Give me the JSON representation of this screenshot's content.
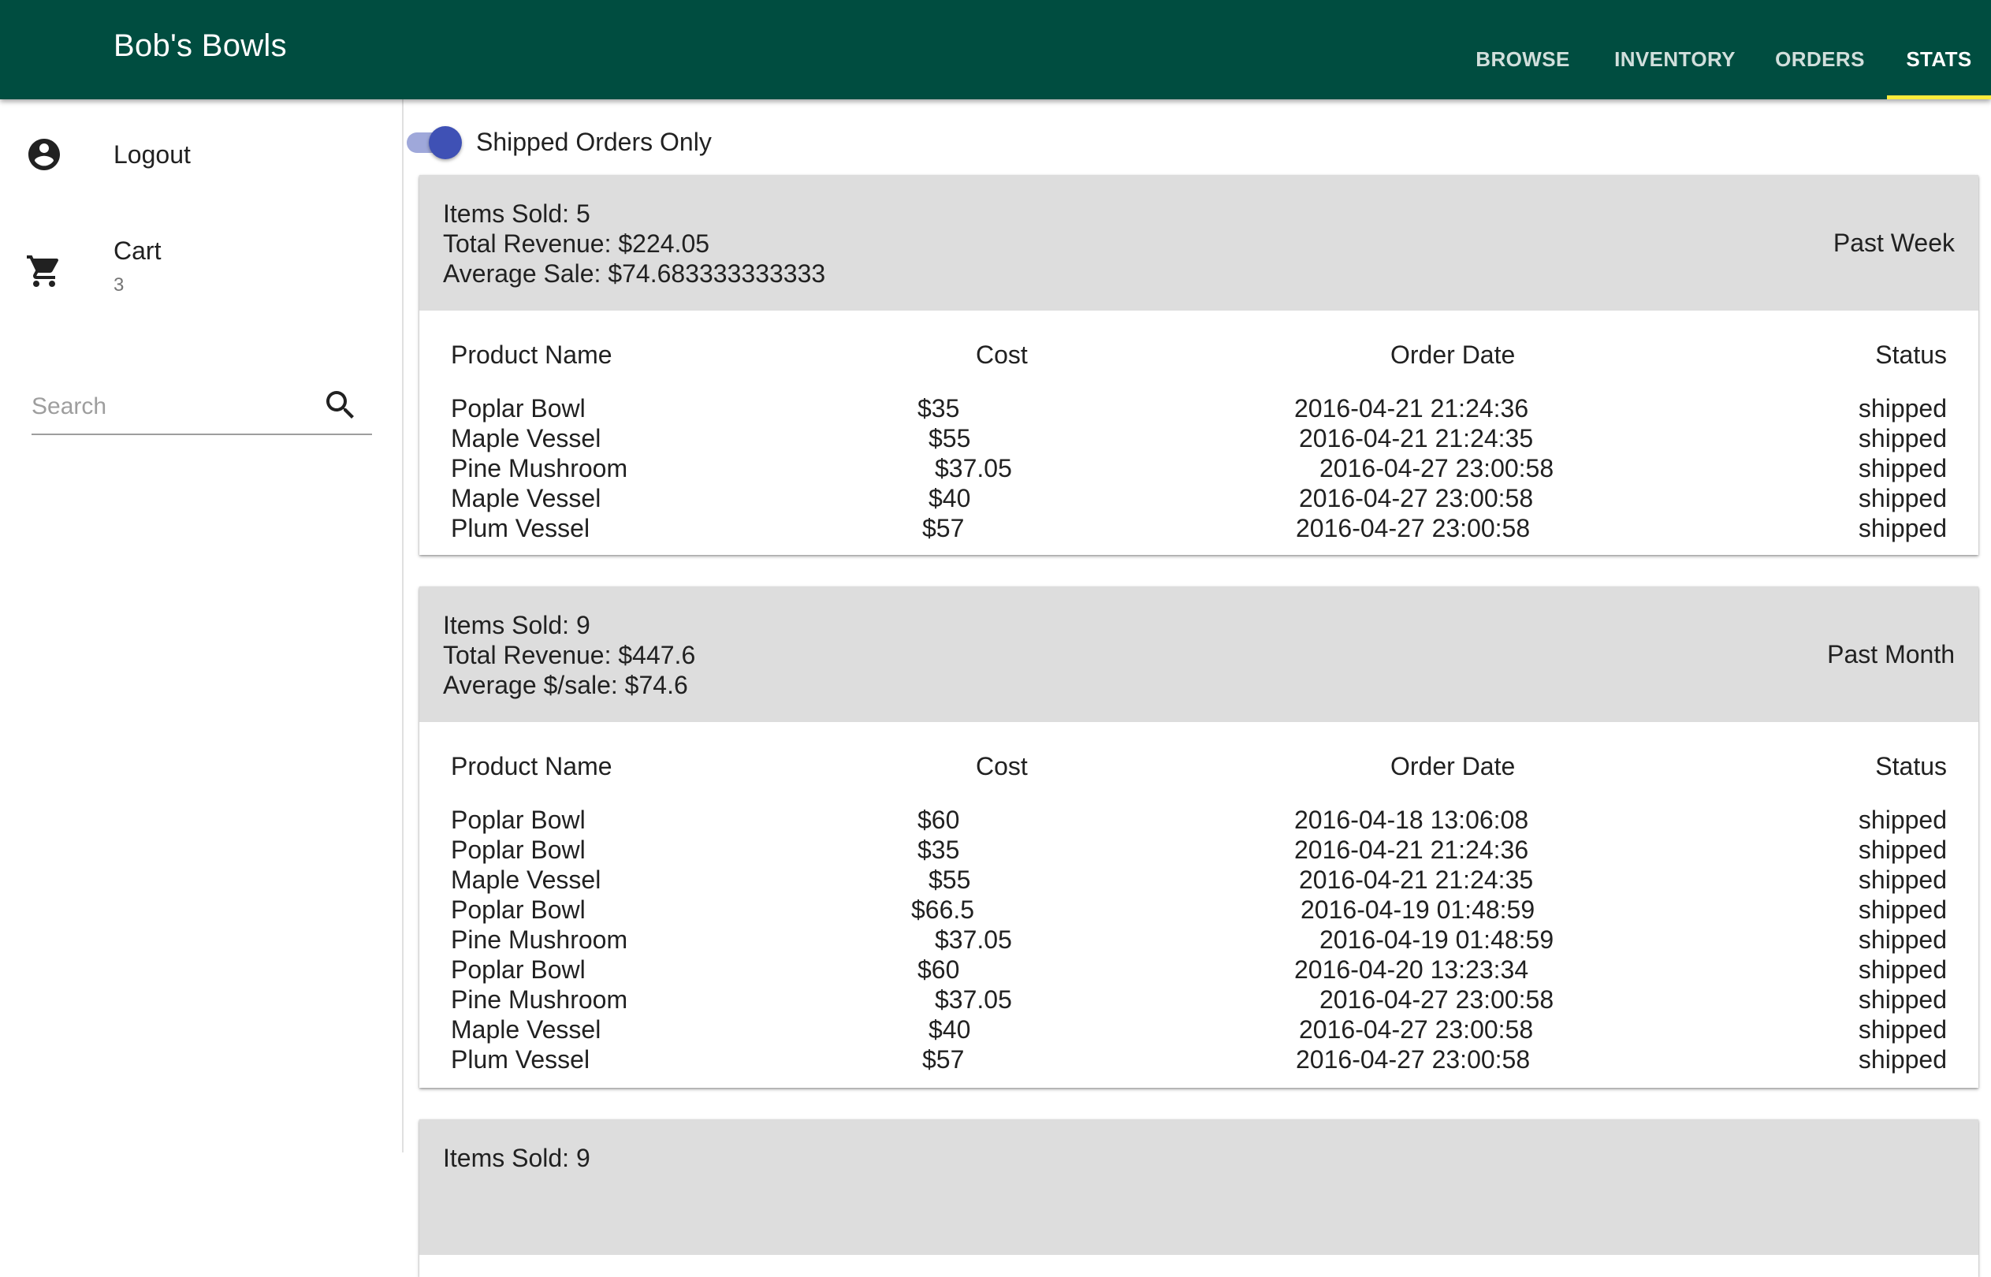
{
  "app": {
    "title": "Bob's Bowls",
    "accent_color": "#004d40",
    "tab_indicator_color": "#ffeb3b"
  },
  "nav": {
    "tabs": [
      {
        "label": "BROWSE",
        "active": false
      },
      {
        "label": "INVENTORY",
        "active": false
      },
      {
        "label": "ORDERS",
        "active": false
      },
      {
        "label": "STATS",
        "active": true
      }
    ]
  },
  "sidebar": {
    "logout": {
      "label": "Logout",
      "icon": "account-circle-icon"
    },
    "cart": {
      "label": "Cart",
      "count": "3",
      "icon": "shopping-cart-icon"
    },
    "search": {
      "placeholder": "Search",
      "value": "",
      "icon": "search-icon"
    }
  },
  "filter": {
    "toggle_label": "Shipped Orders Only",
    "toggle_on": true,
    "toggle_color": "#3f51b5"
  },
  "table_headers": {
    "name": "Product Name",
    "cost": "Cost",
    "date": "Order Date",
    "status": "Status"
  },
  "cards": [
    {
      "items_sold": "Items Sold: 5",
      "total_revenue": "Total Revenue: $224.05",
      "average": "Average Sale: $74.683333333333",
      "period": "Past Week",
      "rows": [
        {
          "name": "Poplar Bowl",
          "cost": "$35",
          "date": "2016-04-21 21:24:36",
          "status": "shipped"
        },
        {
          "name": "Maple Vessel",
          "cost": "$55",
          "date": "2016-04-21 21:24:35",
          "status": "shipped"
        },
        {
          "name": "Pine Mushroom",
          "cost": "$37.05",
          "date": "2016-04-27 23:00:58",
          "status": "shipped"
        },
        {
          "name": "Maple Vessel",
          "cost": "$40",
          "date": "2016-04-27 23:00:58",
          "status": "shipped"
        },
        {
          "name": "Plum Vessel",
          "cost": "$57",
          "date": "2016-04-27 23:00:58",
          "status": "shipped"
        }
      ]
    },
    {
      "items_sold": "Items Sold: 9",
      "total_revenue": "Total Revenue: $447.6",
      "average": "Average $/sale: $74.6",
      "period": "Past Month",
      "rows": [
        {
          "name": "Poplar Bowl",
          "cost": "$60",
          "date": "2016-04-18 13:06:08",
          "status": "shipped"
        },
        {
          "name": "Poplar Bowl",
          "cost": "$35",
          "date": "2016-04-21 21:24:36",
          "status": "shipped"
        },
        {
          "name": "Maple Vessel",
          "cost": "$55",
          "date": "2016-04-21 21:24:35",
          "status": "shipped"
        },
        {
          "name": "Poplar Bowl",
          "cost": "$66.5",
          "date": "2016-04-19 01:48:59",
          "status": "shipped"
        },
        {
          "name": "Pine Mushroom",
          "cost": "$37.05",
          "date": "2016-04-19 01:48:59",
          "status": "shipped"
        },
        {
          "name": "Poplar Bowl",
          "cost": "$60",
          "date": "2016-04-20 13:23:34",
          "status": "shipped"
        },
        {
          "name": "Pine Mushroom",
          "cost": "$37.05",
          "date": "2016-04-27 23:00:58",
          "status": "shipped"
        },
        {
          "name": "Maple Vessel",
          "cost": "$40",
          "date": "2016-04-27 23:00:58",
          "status": "shipped"
        },
        {
          "name": "Plum Vessel",
          "cost": "$57",
          "date": "2016-04-27 23:00:58",
          "status": "shipped"
        }
      ]
    },
    {
      "items_sold": "Items Sold: 9"
    }
  ]
}
